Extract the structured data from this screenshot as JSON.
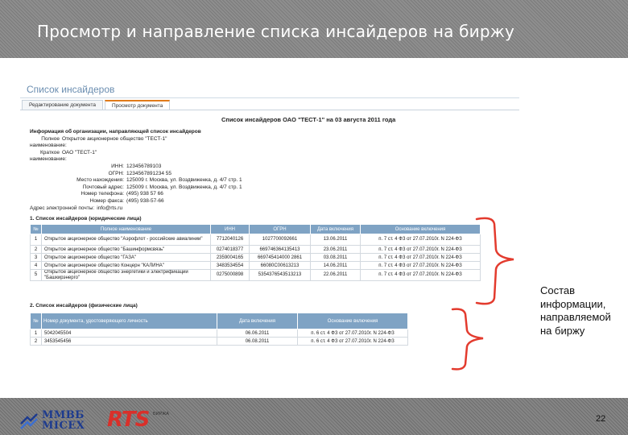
{
  "slide": {
    "title": "Просмотр и направление списка инсайдеров на биржу",
    "annotation_lines": [
      "Состав",
      "информации,",
      "направляемой",
      "на биржу"
    ],
    "page_number": "22",
    "logo_mmvb_line1": "ММВБ",
    "logo_mmvb_line2": "MICEX",
    "logo_rts": "RTS",
    "logo_rts_sub": "БИРЖА",
    "accent_color": "#e33b2e"
  },
  "screen": {
    "section_title": "Список инсайдеров",
    "tabs": [
      {
        "label": "Редактирование документа"
      },
      {
        "label": "Просмотр документа"
      }
    ],
    "doc_title": "Список инсайдеров ОАО \"ТЕСТ-1\" на 03 августа 2011 года",
    "org": {
      "heading": "Информация об организации, направляющей список инсайдеров",
      "rows": [
        {
          "label": "Полное наименование:",
          "value": "Открытое акционерное общество \"ТЕСТ-1\""
        },
        {
          "label": "Краткое наименование:",
          "value": "ОАО \"ТЕСТ-1\""
        },
        {
          "label": "ИНН:",
          "value": "123456789103"
        },
        {
          "label": "ОГРН:",
          "value": "1234567891234 55"
        },
        {
          "label": "Место нахождения:",
          "value": "125009 г. Москва, ул. Воздвиженка, д. 4/7 стр. 1"
        },
        {
          "label": "Почтовый адрес:",
          "value": "125009 г. Москва, ул. Воздвиженка, д. 4/7 стр. 1"
        },
        {
          "label": "Номер телефона:",
          "value": "(495) 938 57 66"
        },
        {
          "label": "Номер факса:",
          "value": "(495) 938-57-66"
        },
        {
          "label": "Адрес электронной почты:",
          "value": "info@rts.ru"
        }
      ]
    },
    "table1": {
      "title": "1. Список инсайдеров (юридические лица)",
      "headers": [
        "№",
        "Полное наименование",
        "ИНН",
        "ОГРН",
        "Дата включения",
        "Основание включения"
      ],
      "rows": [
        [
          "1",
          "Открытое акционерное общество \"Аэрофлот - российские авиалинии\"",
          "7712040126",
          "1027700092661",
          "13.06.2011",
          "п. 7 ст. 4 ФЗ от 27.07.2010г. N 224-ФЗ"
        ],
        [
          "2",
          "Открытое акционерное общество \"Башинформсвязь\"",
          "0274018377",
          "669746364135413",
          "23.06.2011",
          "п. 7 ст. 4 ФЗ от 27.07.2010г. N 224-ФЗ"
        ],
        [
          "3",
          "Открытое акционерное общество \"ГАЗА\"",
          "2359004165",
          "669745414000 2861",
          "03.08.2011",
          "п. 7 ст. 4 ФЗ от 27.07.2010г. N 224-ФЗ"
        ],
        [
          "4",
          "Открытое акционерное общество Концерн \"КАЛИНА\"",
          "3483534554",
          "66080C00613213",
          "14.06.2011",
          "п. 7 ст. 4 ФЗ от 27.07.2010г. N 224-ФЗ"
        ],
        [
          "5",
          "Открытое акционерное общество энергетики и электрификации \"Башкирэнерго\"",
          "0275000898",
          "5354376543513213",
          "22.06.2011",
          "п. 7 ст. 4 ФЗ от 27.07.2010г. N 224-ФЗ"
        ]
      ]
    },
    "table2": {
      "title": "2. Список инсайдеров (физические лица)",
      "headers": [
        "№",
        "Номер документа, удостоверяющего личность",
        "Дата включения",
        "Основание включения"
      ],
      "rows": [
        [
          "1",
          "5042045504",
          "06.06.2011",
          "п. 6 ст. 4 ФЗ от 27.07.2010г. N 224-ФЗ"
        ],
        [
          "2",
          "3453545456",
          "06.08.2011",
          "п. 6 ст. 4 ФЗ от 27.07.2010г. N 224-ФЗ"
        ]
      ]
    }
  }
}
